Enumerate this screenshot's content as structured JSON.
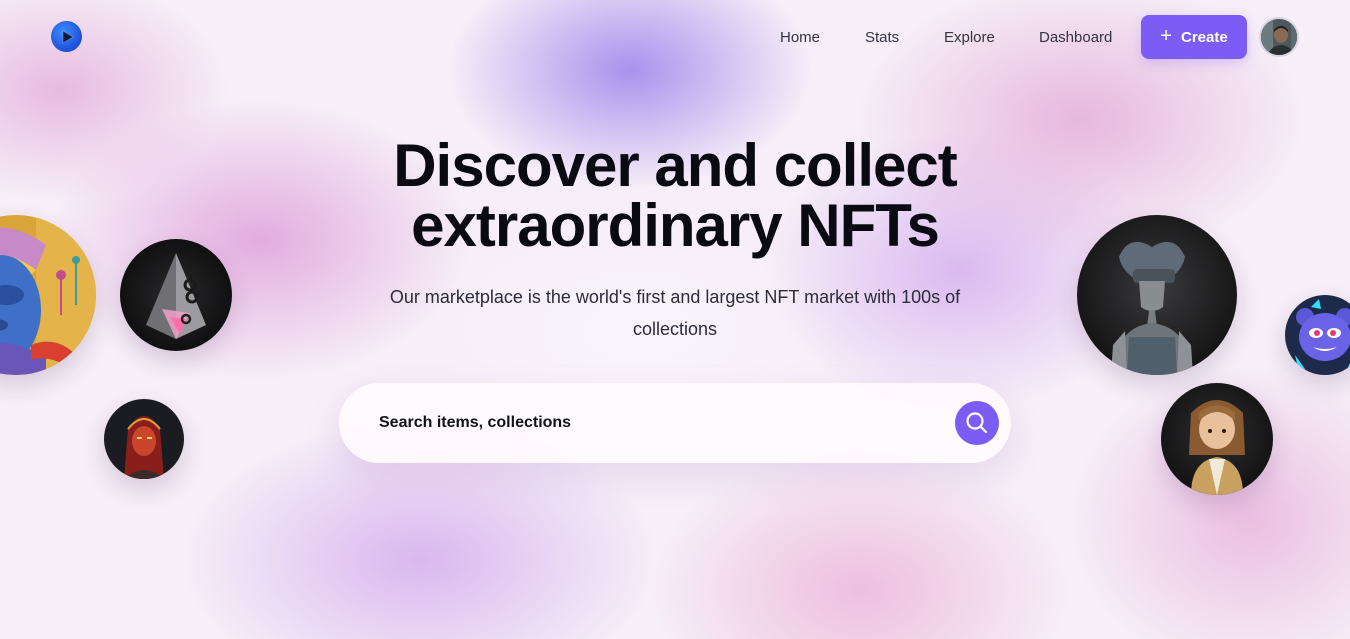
{
  "brand": {
    "logo_icon": "play-logo-icon",
    "logo_color": "#2563eb"
  },
  "nav": {
    "items": [
      {
        "label": "Home"
      },
      {
        "label": "Stats"
      },
      {
        "label": "Explore"
      },
      {
        "label": "Dashboard"
      }
    ],
    "create_label": "Create",
    "create_icon": "plus-icon",
    "accent_color": "#7b5cf5",
    "avatar_icon": "user-avatar"
  },
  "hero": {
    "title_line1": "Discover and collect",
    "title_line2": "extraordinary NFTs",
    "subtitle": "Our marketplace is the world's first and largest NFT market with 100s of collections"
  },
  "search": {
    "placeholder": "Search items, collections",
    "button_icon": "search-icon"
  },
  "nft_images": [
    "colorful-face-nft",
    "glass-pyramid-nft",
    "red-hooded-character-nft",
    "blindfolded-figure-nft",
    "neon-bear-nft",
    "cartoon-girl-nft"
  ]
}
